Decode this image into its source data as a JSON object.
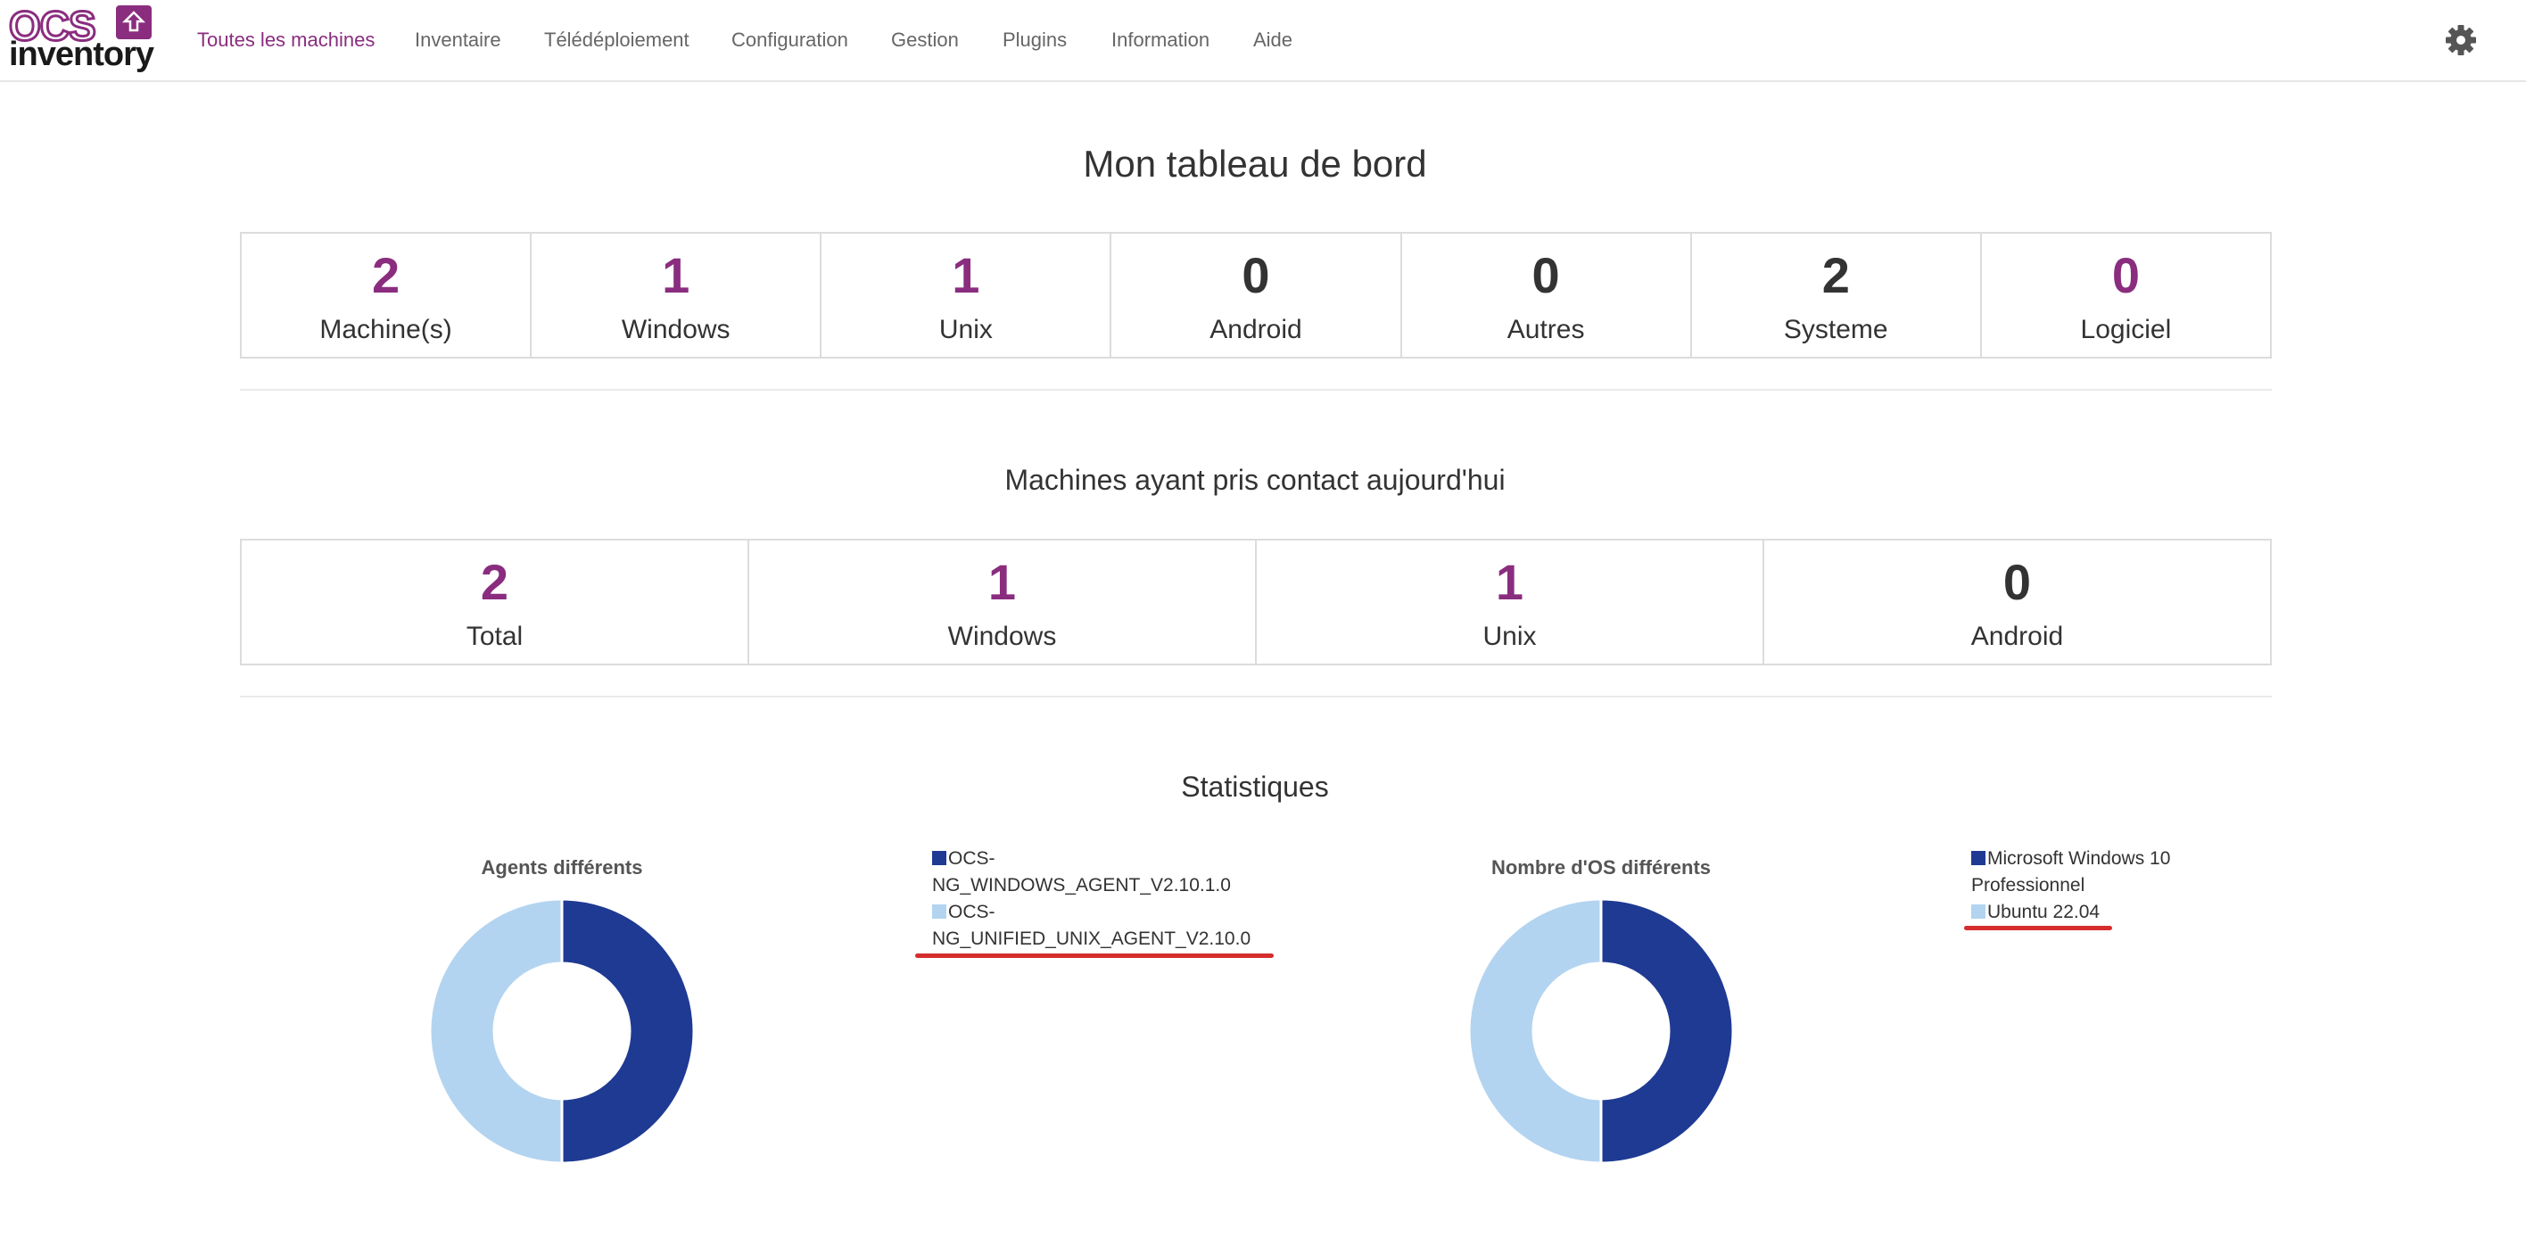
{
  "nav": {
    "items": [
      {
        "label": "Toutes les machines",
        "active": true
      },
      {
        "label": "Inventaire"
      },
      {
        "label": "Télédéploiement"
      },
      {
        "label": "Configuration"
      },
      {
        "label": "Gestion"
      },
      {
        "label": "Plugins"
      },
      {
        "label": "Information"
      },
      {
        "label": "Aide"
      }
    ],
    "settings_icon": "gear-icon"
  },
  "logo": {
    "line1": "OCS",
    "line2": "inventory"
  },
  "dashboard": {
    "title": "Mon tableau de bord",
    "stats": [
      {
        "value": "2",
        "label": "Machine(s)",
        "color": "#8a2d7f"
      },
      {
        "value": "1",
        "label": "Windows",
        "color": "#8a2d7f"
      },
      {
        "value": "1",
        "label": "Unix",
        "color": "#8a2d7f"
      },
      {
        "value": "0",
        "label": "Android",
        "color": "#333333"
      },
      {
        "value": "0",
        "label": "Autres",
        "color": "#333333"
      },
      {
        "value": "2",
        "label": "Systeme",
        "color": "#333333"
      },
      {
        "value": "0",
        "label": "Logiciel",
        "color": "#8a2d7f"
      }
    ]
  },
  "today": {
    "title": "Machines ayant pris contact aujourd'hui",
    "stats": [
      {
        "value": "2",
        "label": "Total",
        "color": "#8a2d7f"
      },
      {
        "value": "1",
        "label": "Windows",
        "color": "#8a2d7f"
      },
      {
        "value": "1",
        "label": "Unix",
        "color": "#8a2d7f"
      },
      {
        "value": "0",
        "label": "Android",
        "color": "#333333"
      }
    ]
  },
  "statistics": {
    "title": "Statistiques"
  },
  "chart_data": [
    {
      "type": "pie",
      "title": "Agents différents",
      "categories": [
        "OCS-NG_WINDOWS_AGENT_V2.10.1.0",
        "OCS-NG_UNIFIED_UNIX_AGENT_V2.10.0"
      ],
      "legend_lines": [
        [
          "OCS-",
          "NG_WINDOWS_AGENT_V2.10.1.0"
        ],
        [
          "OCS-",
          "NG_UNIFIED_UNIX_AGENT_V2.10.0"
        ]
      ],
      "values": [
        1,
        1
      ],
      "colors": [
        "#1f3a93",
        "#b3d4f0"
      ],
      "legend_placement": "right"
    },
    {
      "type": "pie",
      "title": "Nombre d'OS différents",
      "categories": [
        "Microsoft Windows 10 Professionnel",
        "Ubuntu 22.04"
      ],
      "legend_lines": [
        [
          "Microsoft Windows 10",
          "Professionnel"
        ],
        [
          "Ubuntu 22.04"
        ]
      ],
      "values": [
        1,
        1
      ],
      "colors": [
        "#1f3a93",
        "#b3d4f0"
      ],
      "legend_placement": "right"
    }
  ]
}
